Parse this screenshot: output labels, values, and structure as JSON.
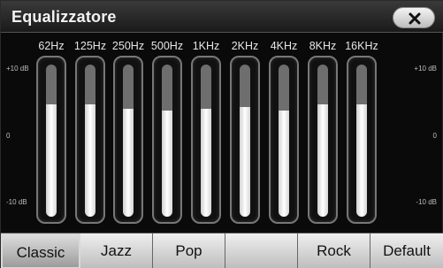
{
  "window": {
    "title": "Equalizzatore"
  },
  "close_button": {
    "icon": "close-icon"
  },
  "scale": {
    "top": "+10 dB",
    "middle": "0",
    "bottom": "-10 dB"
  },
  "bands": [
    {
      "label": "62Hz",
      "level": 0.74
    },
    {
      "label": "125Hz",
      "level": 0.74
    },
    {
      "label": "250Hz",
      "level": 0.71
    },
    {
      "label": "500Hz",
      "level": 0.7
    },
    {
      "label": "1KHz",
      "level": 0.71
    },
    {
      "label": "2KHz",
      "level": 0.72
    },
    {
      "label": "4KHz",
      "level": 0.7
    },
    {
      "label": "8KHz",
      "level": 0.74
    },
    {
      "label": "16KHz",
      "level": 0.74
    }
  ],
  "presets": [
    {
      "label": "Classic",
      "selected": true
    },
    {
      "label": "Jazz",
      "selected": false
    },
    {
      "label": "Pop",
      "selected": false
    },
    {
      "label": "",
      "selected": false
    },
    {
      "label": "Rock",
      "selected": false
    },
    {
      "label": "Default",
      "selected": false
    }
  ]
}
